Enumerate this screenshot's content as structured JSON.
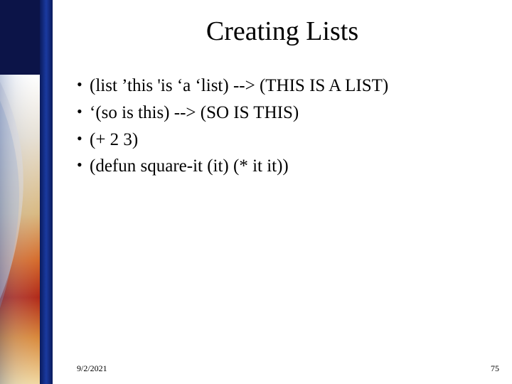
{
  "slide": {
    "title": "Creating Lists",
    "bullets": [
      "(list  ’this  'is  ‘a  ‘list) --> (THIS IS A LIST)",
      " ‘(so  is  this) --> (SO IS THIS)",
      "(+ 2 3)",
      "(defun square-it (it) (* it it))"
    ],
    "date": "9/2/2021",
    "page": "75"
  }
}
